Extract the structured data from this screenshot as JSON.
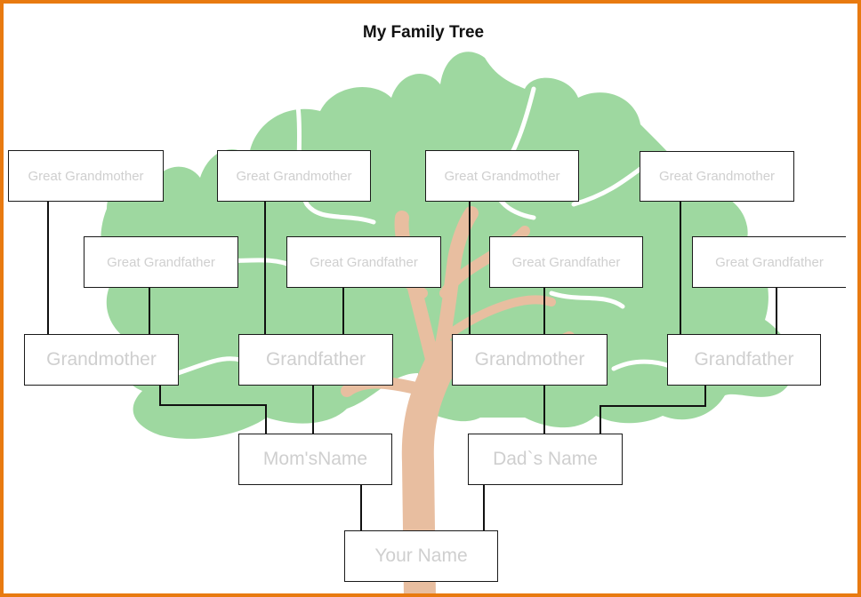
{
  "title": "My Family Tree",
  "colors": {
    "frame": "#e87a10",
    "foliage": "#9ed8a0",
    "trunk": "#e8bea0",
    "box_border": "#1a1a1a",
    "placeholder_text": "#cfcfcf"
  },
  "tree": {
    "great_grandmothers": [
      {
        "label": "Great Grandmother"
      },
      {
        "label": "Great Grandmother"
      },
      {
        "label": "Great Grandmother"
      },
      {
        "label": "Great Grandmother"
      }
    ],
    "great_grandfathers": [
      {
        "label": "Great Grandfather"
      },
      {
        "label": "Great Grandfather"
      },
      {
        "label": "Great Grandfather"
      },
      {
        "label": "Great Grandfather"
      }
    ],
    "grandparents": [
      {
        "label": "Grandmother"
      },
      {
        "label": "Grandfather"
      },
      {
        "label": "Grandmother"
      },
      {
        "label": "Grandfather"
      }
    ],
    "parents": [
      {
        "label": "Mom'sName"
      },
      {
        "label": "Dad`s Name"
      }
    ],
    "self": {
      "label": "Your Name"
    }
  }
}
